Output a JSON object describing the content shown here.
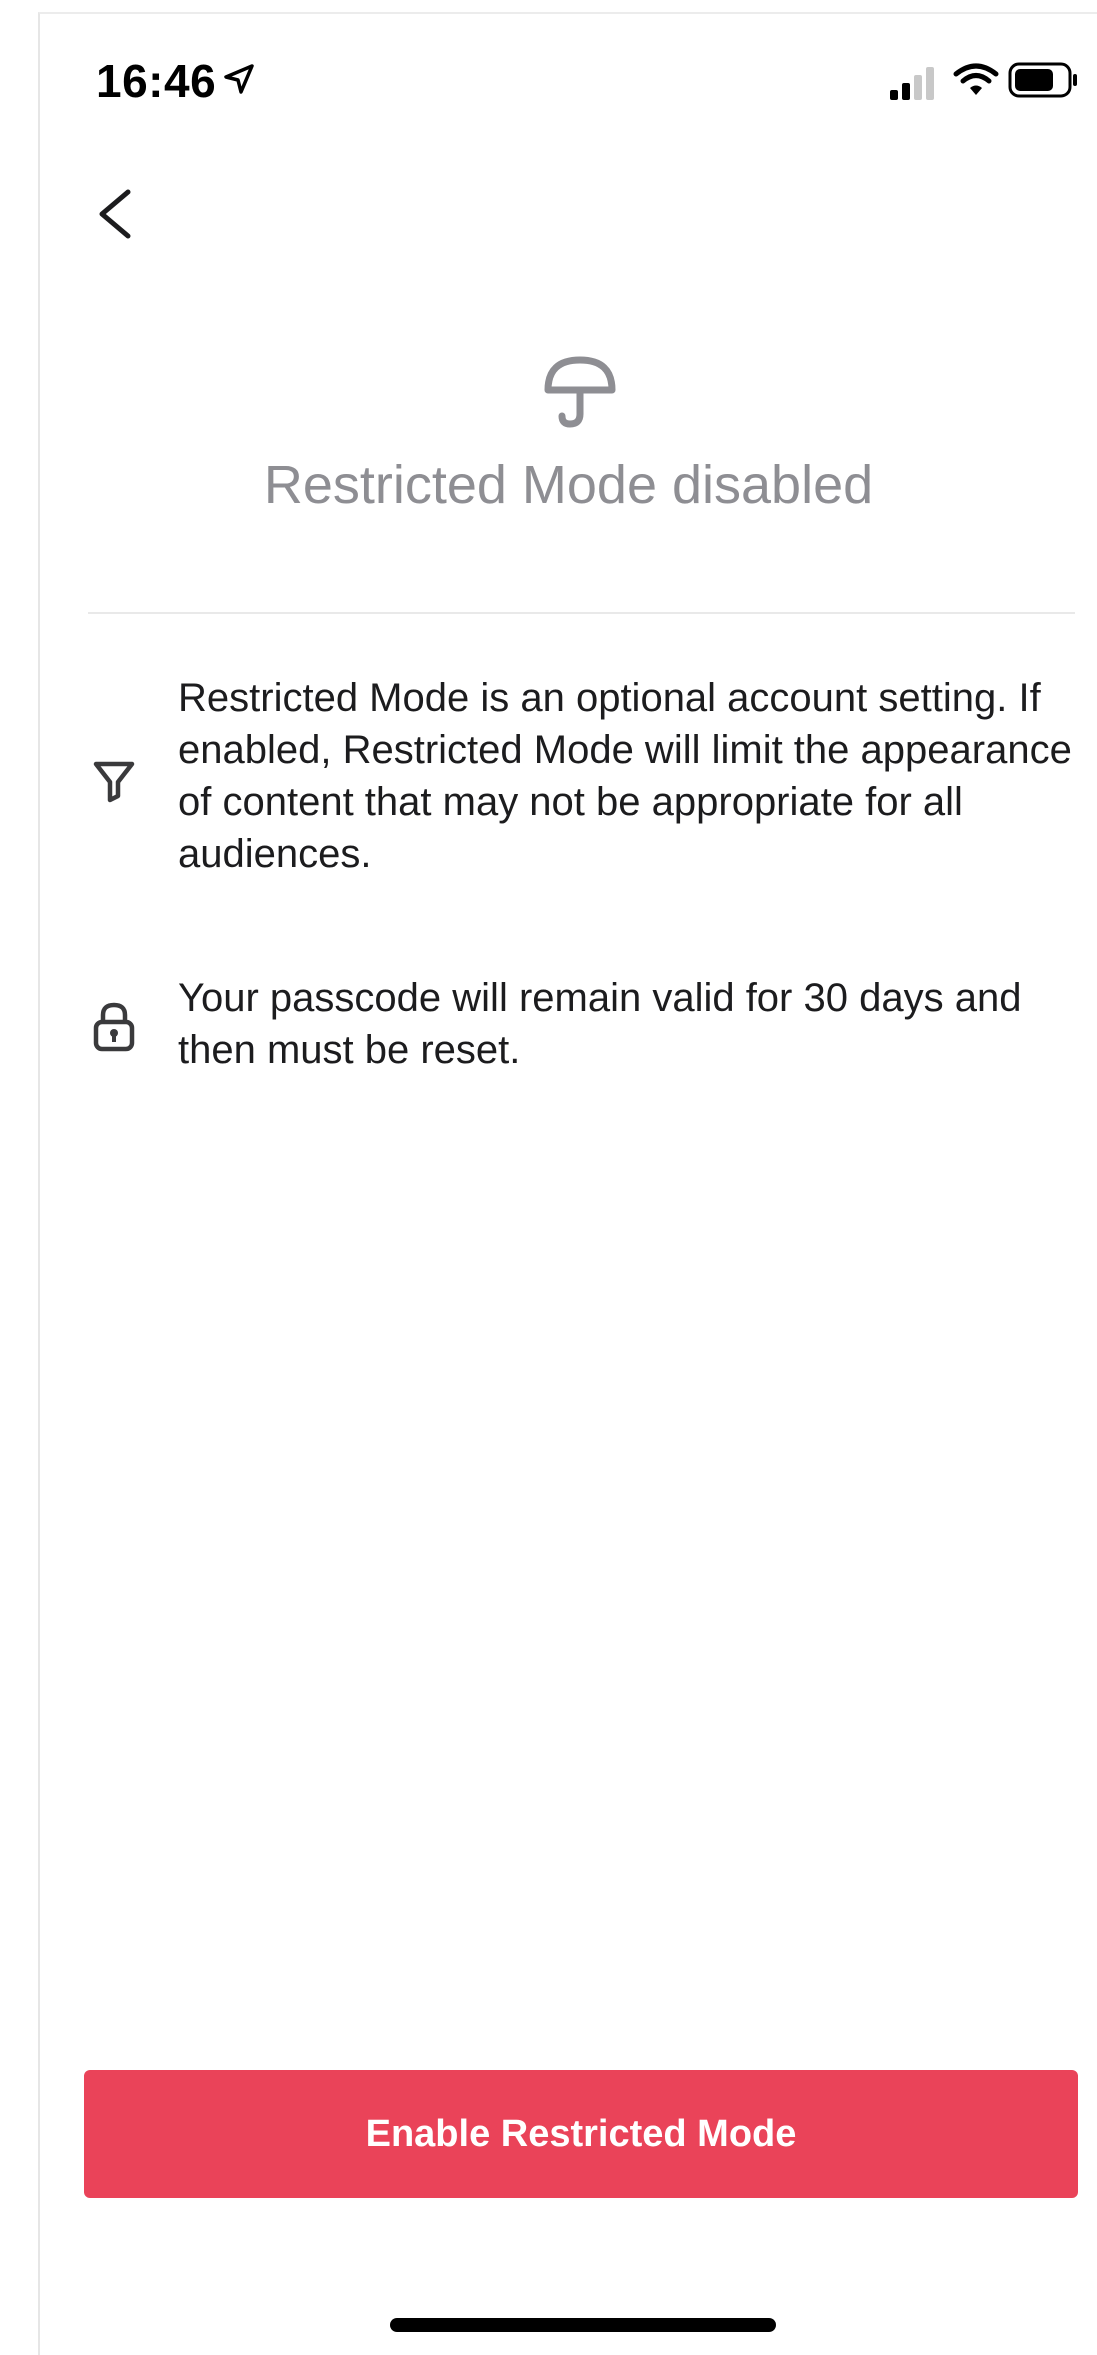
{
  "status_bar": {
    "time": "16:46",
    "icons": [
      "location-arrow-icon",
      "signal-icon",
      "wifi-icon",
      "battery-icon"
    ]
  },
  "navigation": {
    "back_icon": "chevron-left-icon"
  },
  "header": {
    "icon": "umbrella-icon",
    "title": "Restricted Mode disabled"
  },
  "info": [
    {
      "icon": "filter-icon",
      "text": "Restricted Mode is an optional account setting. If enabled, Restricted Mode will limit the appearance of content that may not be appropriate for all audiences."
    },
    {
      "icon": "lock-icon",
      "text": "Your passcode will remain valid for 30 days and then must be reset."
    }
  ],
  "actions": {
    "enable_label": "Enable Restricted Mode"
  },
  "colors": {
    "accent": "#ea4359",
    "title_gray": "#8e8e93",
    "text": "#1c1c1e"
  }
}
